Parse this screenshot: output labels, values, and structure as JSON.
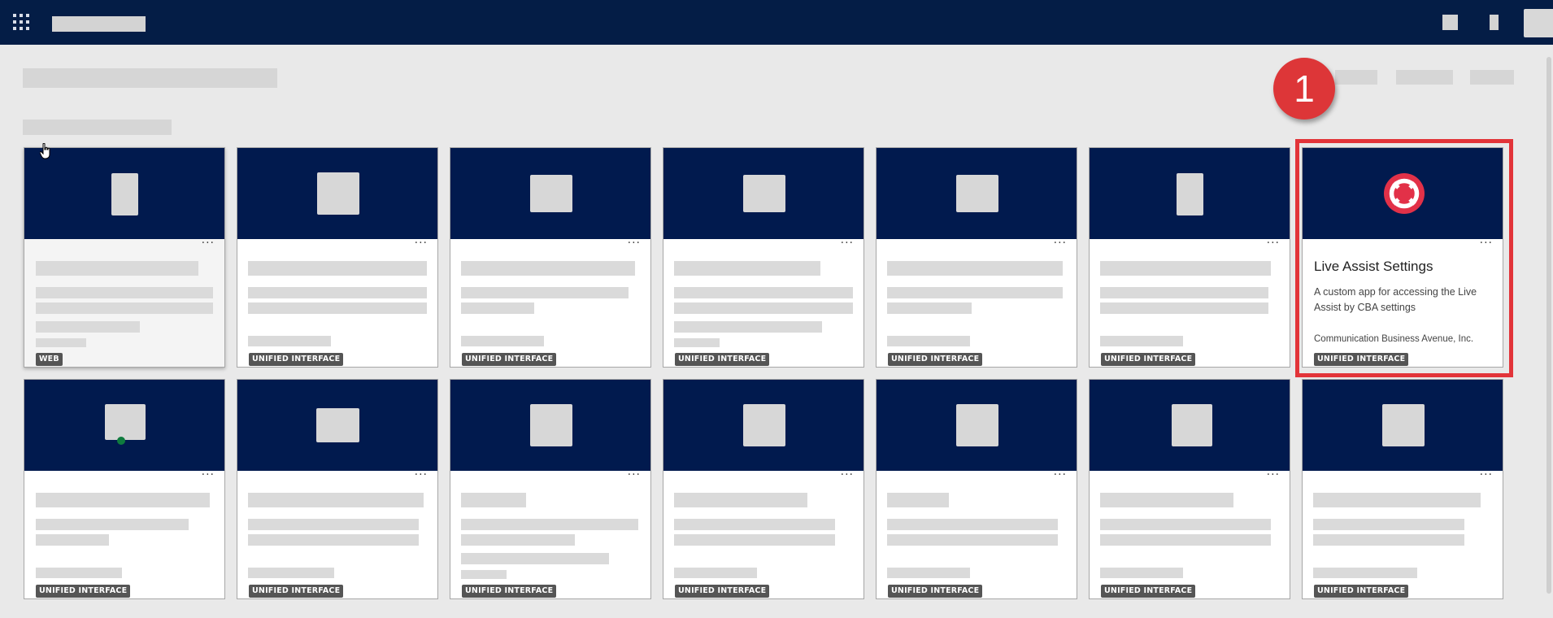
{
  "topbar": {
    "waffle_icon": "waffle-icon"
  },
  "colors": {
    "banner": "#011a4e",
    "topbar": "#041d46",
    "highlight": "#e23439",
    "badge": "#555555",
    "page_bg": "#e9e9e9"
  },
  "callout": {
    "number": "1"
  },
  "featured_app": {
    "title": "Live Assist Settings",
    "description": "A custom app for accessing the Live Assist by CBA settings",
    "publisher": "Communication Business Avenue, Inc.",
    "icon": "lifebuoy-icon",
    "icon_color": "#e23148"
  },
  "cards": [
    {
      "badge": "WEB"
    },
    {
      "badge": "UNIFIED INTERFACE"
    },
    {
      "badge": "UNIFIED INTERFACE"
    },
    {
      "badge": "UNIFIED INTERFACE"
    },
    {
      "badge": "UNIFIED INTERFACE"
    },
    {
      "badge": "UNIFIED INTERFACE"
    },
    {
      "badge": "UNIFIED INTERFACE"
    },
    {
      "badge": "UNIFIED INTERFACE"
    },
    {
      "badge": "UNIFIED INTERFACE"
    },
    {
      "badge": "UNIFIED INTERFACE"
    },
    {
      "badge": "UNIFIED INTERFACE"
    },
    {
      "badge": "UNIFIED INTERFACE"
    },
    {
      "badge": "UNIFIED INTERFACE"
    },
    {
      "badge": "UNIFIED INTERFACE"
    }
  ],
  "more_label": "···"
}
